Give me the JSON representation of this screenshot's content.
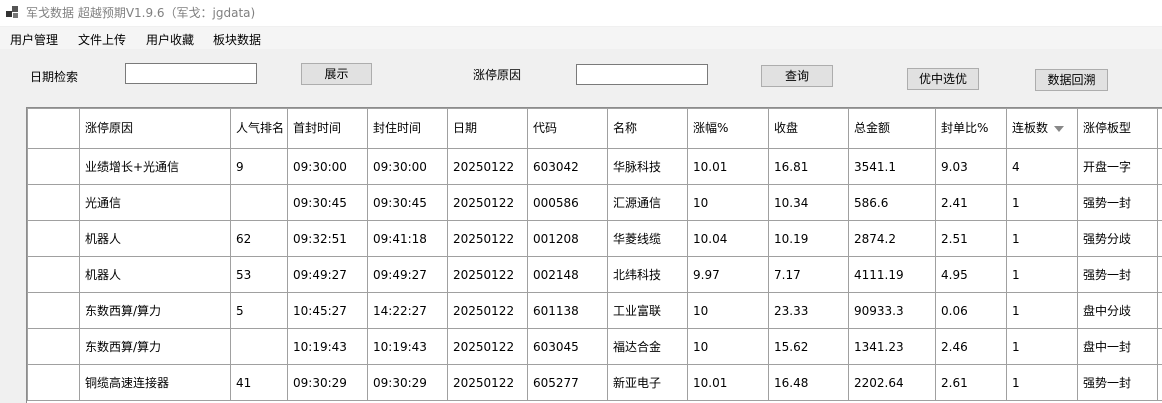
{
  "window": {
    "title": "军戈数据 超越预期V1.9.6（军戈：jgdata)"
  },
  "menu": {
    "items": [
      "用户管理",
      "文件上传",
      "用户收藏",
      "板块数据"
    ]
  },
  "toolbar": {
    "date_search_label": "日期检索",
    "date_search_value": "",
    "show_button": "展示",
    "reason_label": "涨停原因",
    "reason_value": "",
    "query_button": "查询",
    "select_button": "优中选优",
    "backtrack_button": "数据回溯"
  },
  "table": {
    "sorted_column": "连板数",
    "columns": [
      "涨停原因",
      "人气排名",
      "首封时间",
      "封住时间",
      "日期",
      "代码",
      "名称",
      "涨幅%",
      "收盘",
      "总金额",
      "封单比%",
      "连板数",
      "涨停板型"
    ],
    "rows": [
      [
        "业绩增长+光通信",
        "9",
        "09:30:00",
        "09:30:00",
        "20250122",
        "603042",
        "华脉科技",
        "10.01",
        "16.81",
        "3541.1",
        "9.03",
        "4",
        "开盘一字"
      ],
      [
        "光通信",
        "",
        "09:30:45",
        "09:30:45",
        "20250122",
        "000586",
        "汇源通信",
        "10",
        "10.34",
        "586.6",
        "2.41",
        "1",
        "强势一封"
      ],
      [
        "机器人",
        "62",
        "09:32:51",
        "09:41:18",
        "20250122",
        "001208",
        "华菱线缆",
        "10.04",
        "10.19",
        "2874.2",
        "2.51",
        "1",
        "强势分歧"
      ],
      [
        "机器人",
        "53",
        "09:49:27",
        "09:49:27",
        "20250122",
        "002148",
        "北纬科技",
        "9.97",
        "7.17",
        "4111.19",
        "4.95",
        "1",
        "强势一封"
      ],
      [
        "东数西算/算力",
        "5",
        "10:45:27",
        "14:22:27",
        "20250122",
        "601138",
        "工业富联",
        "10",
        "23.33",
        "90933.3",
        "0.06",
        "1",
        "盘中分歧"
      ],
      [
        "东数西算/算力",
        "",
        "10:19:43",
        "10:19:43",
        "20250122",
        "603045",
        "福达合金",
        "10",
        "15.62",
        "1341.23",
        "2.46",
        "1",
        "盘中一封"
      ],
      [
        "铜缆高速连接器",
        "41",
        "09:30:29",
        "09:30:29",
        "20250122",
        "605277",
        "新亚电子",
        "10.01",
        "16.48",
        "2202.64",
        "2.61",
        "1",
        "强势一封"
      ]
    ]
  }
}
